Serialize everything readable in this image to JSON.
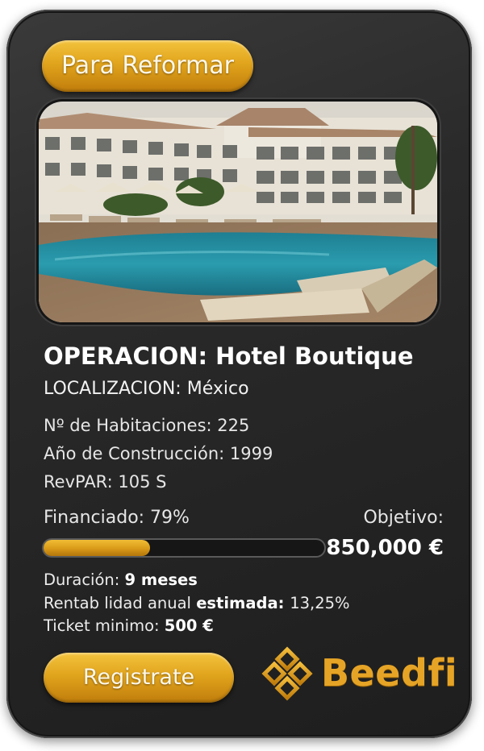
{
  "card": {
    "badge_label": "Para Reformar",
    "photo_alt": "",
    "title": "OPERACION: Hotel Boutique",
    "location": "LOCALIZACION: México",
    "specs": [
      "Nº de Habitaciones: 225",
      "Año de Construcción: 1999",
      "RevPAR: 105 S"
    ],
    "funding": {
      "label": "Financiado: 79%",
      "progress_fraction": 0.38,
      "target_label": "Objetivo:",
      "target_value": "850,000 €"
    },
    "details": [
      {
        "label": "Duración: ",
        "value": "9 meses"
      },
      {
        "label": "Rentab lidad anual ",
        "value": "estimada: ",
        "suffix": "13,25%"
      },
      {
        "label": "Ticket minimo: ",
        "value": "500 €"
      }
    ],
    "cta_label": "Registrate",
    "brand": {
      "name": "Beedfi",
      "color": "#e6a426"
    }
  },
  "colors": {
    "gold_light": "#f3c33e",
    "gold_dark": "#c07d0c",
    "card_bg": "#2a2a2a",
    "text": "#f2f2f2"
  }
}
